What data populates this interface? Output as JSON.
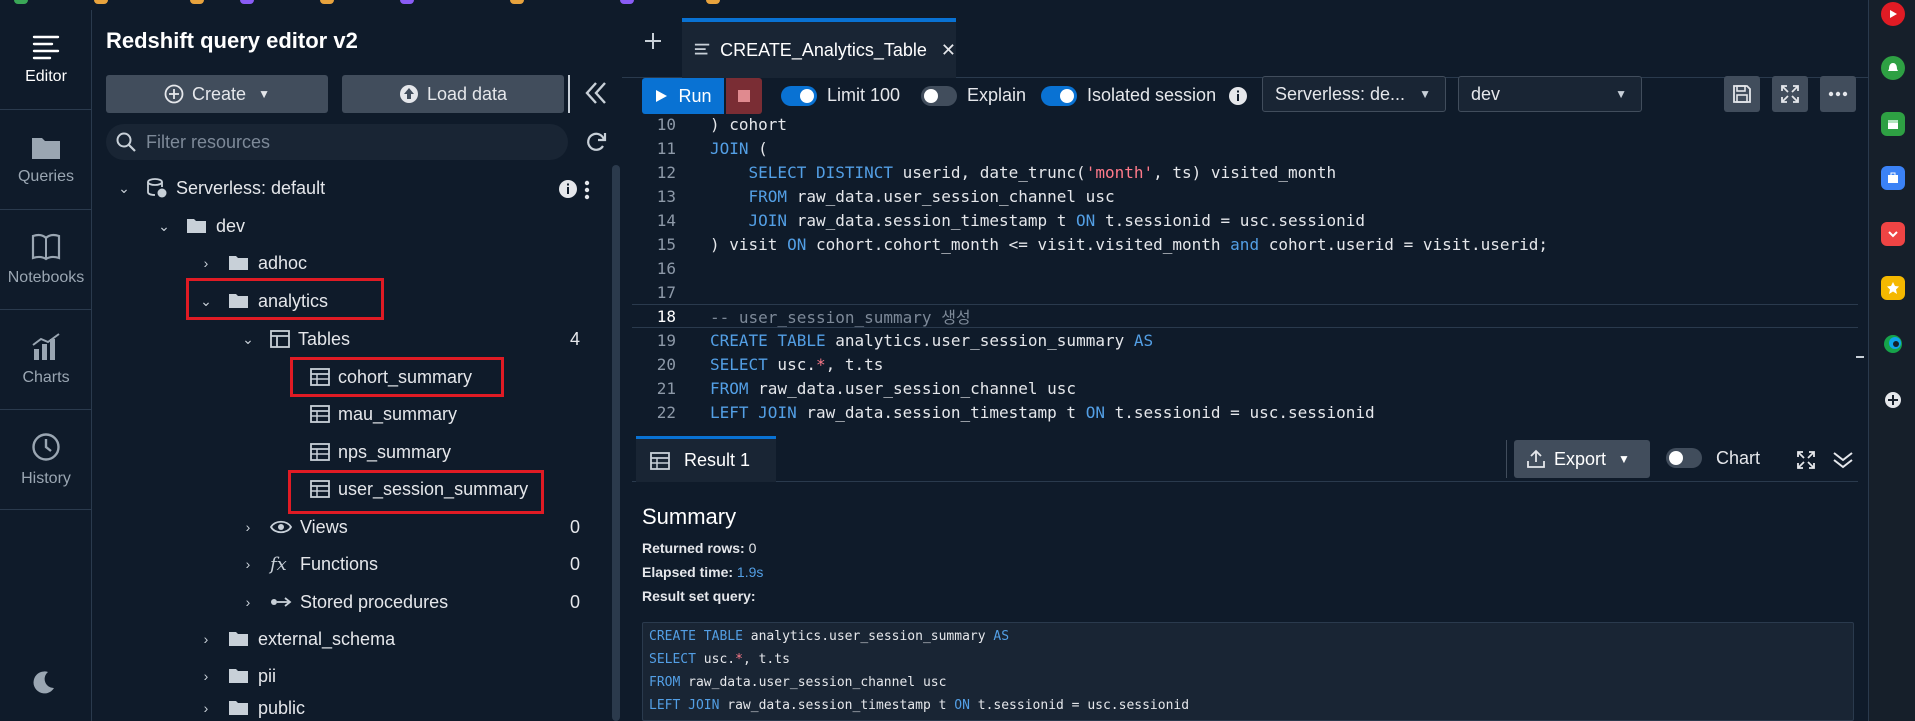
{
  "app": {
    "title": "Redshift query editor v2"
  },
  "rail": {
    "items": [
      {
        "label": "Editor",
        "icon": "editor-icon"
      },
      {
        "label": "Queries",
        "icon": "folder-icon"
      },
      {
        "label": "Notebooks",
        "icon": "notebook-icon"
      },
      {
        "label": "Charts",
        "icon": "chart-icon"
      },
      {
        "label": "History",
        "icon": "clock-icon"
      }
    ],
    "theme_icon": "moon-icon"
  },
  "panel": {
    "create_label": "Create",
    "load_label": "Load data",
    "filter_placeholder": "Filter resources",
    "tree": {
      "serverless": "Serverless: default",
      "dev": "dev",
      "adhoc": "adhoc",
      "analytics": "analytics",
      "tables": "Tables",
      "tables_count": "4",
      "table_items": [
        "cohort_summary",
        "mau_summary",
        "nps_summary",
        "user_session_summary"
      ],
      "views": "Views",
      "views_count": "0",
      "functions": "Functions",
      "functions_count": "0",
      "stored_procedures": "Stored procedures",
      "stored_procedures_count": "0",
      "external_schema": "external_schema",
      "pii": "pii",
      "public": "public"
    }
  },
  "editor": {
    "new_tab_icon": "plus-icon",
    "tab_label": "CREATE_Analytics_Table",
    "run_label": "Run",
    "limit_label": "Limit 100",
    "explain_label": "Explain",
    "isolated_label": "Isolated session",
    "workgroup_select": "Serverless: de...",
    "database_select": "dev",
    "lines": [
      {
        "n": "10",
        "text": ") cohort"
      },
      {
        "n": "11",
        "text": "JOIN ("
      },
      {
        "n": "12",
        "text": "    SELECT DISTINCT userid, date_trunc('month', ts) visited_month"
      },
      {
        "n": "13",
        "text": "    FROM raw_data.user_session_channel usc"
      },
      {
        "n": "14",
        "text": "    JOIN raw_data.session_timestamp t ON t.sessionid = usc.sessionid"
      },
      {
        "n": "15",
        "text": ") visit ON cohort.cohort_month <= visit.visited_month and cohort.userid = visit.userid;"
      },
      {
        "n": "16",
        "text": ""
      },
      {
        "n": "17",
        "text": ""
      },
      {
        "n": "18",
        "text": "-- user_session_summary 생성"
      },
      {
        "n": "19",
        "text": "CREATE TABLE analytics.user_session_summary AS"
      },
      {
        "n": "20",
        "text": "SELECT usc.*, t.ts"
      },
      {
        "n": "21",
        "text": "FROM raw_data.user_session_channel usc"
      },
      {
        "n": "22",
        "text": "LEFT JOIN raw_data.session_timestamp t ON t.sessionid = usc.sessionid"
      }
    ]
  },
  "results": {
    "tab_label": "Result 1",
    "export_label": "Export",
    "chart_label": "Chart",
    "summary_title": "Summary",
    "returned_rows_label": "Returned rows:",
    "returned_rows_value": "0",
    "elapsed_label": "Elapsed time:",
    "elapsed_value": "1.9s",
    "result_query_label": "Result set query:",
    "query_lines": [
      "CREATE TABLE analytics.user_session_summary AS",
      "SELECT usc.*, t.ts",
      "FROM raw_data.user_session_channel usc",
      "LEFT JOIN raw_data.session_timestamp t ON t.sessionid = usc.sessionid"
    ]
  },
  "colors": {
    "accent": "#0972d3",
    "highlight": "#e01b24",
    "background": "#0f1b2a"
  }
}
